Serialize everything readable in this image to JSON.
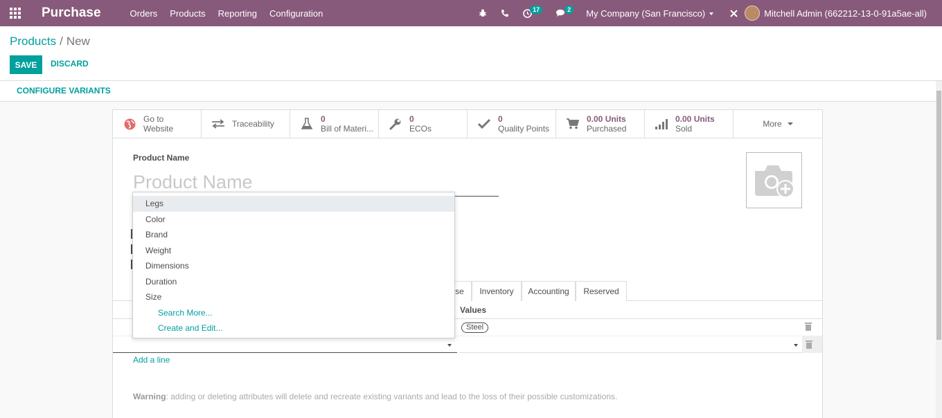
{
  "navbar": {
    "app_title": "Purchase",
    "menu": [
      "Orders",
      "Products",
      "Reporting",
      "Configuration"
    ],
    "activity_count": "17",
    "message_count": "2",
    "company": "My Company (San Francisco)",
    "user": "Mitchell Admin (662212-13-0-91a5ae-all)"
  },
  "breadcrumb": {
    "parent": "Products",
    "separator": "/",
    "current": "New"
  },
  "actions": {
    "save": "SAVE",
    "discard": "DISCARD"
  },
  "statusbar": {
    "configure_variants": "CONFIGURE VARIANTS"
  },
  "smart_buttons": [
    {
      "icon": "globe-icon",
      "value": "",
      "label": "Go to Website"
    },
    {
      "icon": "exchange-icon",
      "value": "",
      "label": "Traceability"
    },
    {
      "icon": "flask-icon",
      "value": "0",
      "label": "Bill of Materi..."
    },
    {
      "icon": "wrench-icon",
      "value": "0",
      "label": "ECOs"
    },
    {
      "icon": "check-icon",
      "value": "0",
      "label": "Quality Points"
    },
    {
      "icon": "cart-icon",
      "value": "0.00 Units",
      "label": "Purchased"
    },
    {
      "icon": "signal-icon",
      "value": "0.00 Units",
      "label": "Sold"
    }
  ],
  "more_label": "More",
  "form": {
    "product_name_label": "Product Name",
    "product_name_placeholder": "Product Name"
  },
  "tabs": [
    "se",
    "Inventory",
    "Accounting",
    "Reserved"
  ],
  "attribute_table": {
    "values_header": "Values",
    "row_value_tag": "Steel",
    "add_line": "Add a line"
  },
  "warning": {
    "title": "Warning",
    "text": ": adding or deleting attributes will delete and recreate existing variants and lead to the loss of their possible customizations."
  },
  "dropdown": {
    "items": [
      "Legs",
      "Color",
      "Brand",
      "Weight",
      "Dimensions",
      "Duration",
      "Size"
    ],
    "search_more": "Search More...",
    "create_edit": "Create and Edit..."
  }
}
